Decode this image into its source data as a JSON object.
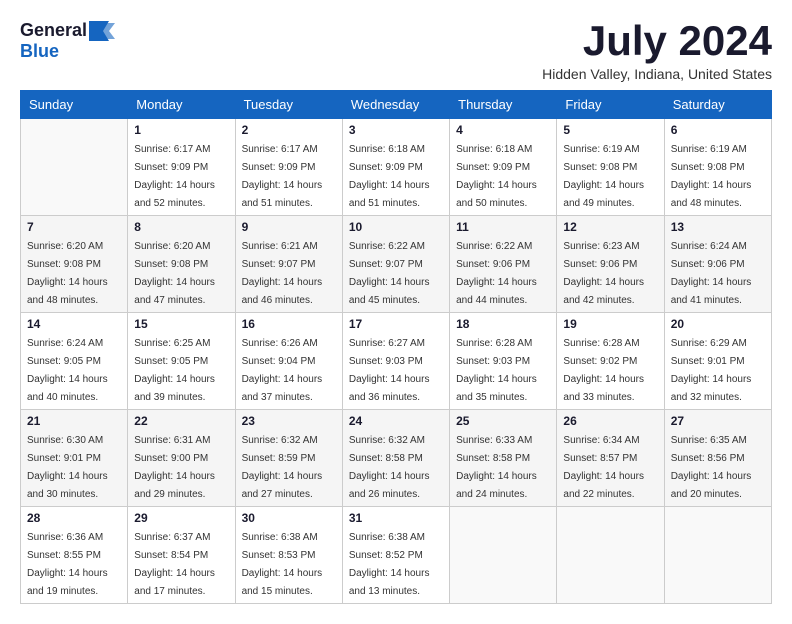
{
  "header": {
    "logo_general": "General",
    "logo_blue": "Blue",
    "title": "July 2024",
    "subtitle": "Hidden Valley, Indiana, United States"
  },
  "weekdays": [
    "Sunday",
    "Monday",
    "Tuesday",
    "Wednesday",
    "Thursday",
    "Friday",
    "Saturday"
  ],
  "weeks": [
    [
      {
        "day": "",
        "sunrise": "",
        "sunset": "",
        "daylight": ""
      },
      {
        "day": "1",
        "sunrise": "Sunrise: 6:17 AM",
        "sunset": "Sunset: 9:09 PM",
        "daylight": "Daylight: 14 hours and 52 minutes."
      },
      {
        "day": "2",
        "sunrise": "Sunrise: 6:17 AM",
        "sunset": "Sunset: 9:09 PM",
        "daylight": "Daylight: 14 hours and 51 minutes."
      },
      {
        "day": "3",
        "sunrise": "Sunrise: 6:18 AM",
        "sunset": "Sunset: 9:09 PM",
        "daylight": "Daylight: 14 hours and 51 minutes."
      },
      {
        "day": "4",
        "sunrise": "Sunrise: 6:18 AM",
        "sunset": "Sunset: 9:09 PM",
        "daylight": "Daylight: 14 hours and 50 minutes."
      },
      {
        "day": "5",
        "sunrise": "Sunrise: 6:19 AM",
        "sunset": "Sunset: 9:08 PM",
        "daylight": "Daylight: 14 hours and 49 minutes."
      },
      {
        "day": "6",
        "sunrise": "Sunrise: 6:19 AM",
        "sunset": "Sunset: 9:08 PM",
        "daylight": "Daylight: 14 hours and 48 minutes."
      }
    ],
    [
      {
        "day": "7",
        "sunrise": "Sunrise: 6:20 AM",
        "sunset": "Sunset: 9:08 PM",
        "daylight": "Daylight: 14 hours and 48 minutes."
      },
      {
        "day": "8",
        "sunrise": "Sunrise: 6:20 AM",
        "sunset": "Sunset: 9:08 PM",
        "daylight": "Daylight: 14 hours and 47 minutes."
      },
      {
        "day": "9",
        "sunrise": "Sunrise: 6:21 AM",
        "sunset": "Sunset: 9:07 PM",
        "daylight": "Daylight: 14 hours and 46 minutes."
      },
      {
        "day": "10",
        "sunrise": "Sunrise: 6:22 AM",
        "sunset": "Sunset: 9:07 PM",
        "daylight": "Daylight: 14 hours and 45 minutes."
      },
      {
        "day": "11",
        "sunrise": "Sunrise: 6:22 AM",
        "sunset": "Sunset: 9:06 PM",
        "daylight": "Daylight: 14 hours and 44 minutes."
      },
      {
        "day": "12",
        "sunrise": "Sunrise: 6:23 AM",
        "sunset": "Sunset: 9:06 PM",
        "daylight": "Daylight: 14 hours and 42 minutes."
      },
      {
        "day": "13",
        "sunrise": "Sunrise: 6:24 AM",
        "sunset": "Sunset: 9:06 PM",
        "daylight": "Daylight: 14 hours and 41 minutes."
      }
    ],
    [
      {
        "day": "14",
        "sunrise": "Sunrise: 6:24 AM",
        "sunset": "Sunset: 9:05 PM",
        "daylight": "Daylight: 14 hours and 40 minutes."
      },
      {
        "day": "15",
        "sunrise": "Sunrise: 6:25 AM",
        "sunset": "Sunset: 9:05 PM",
        "daylight": "Daylight: 14 hours and 39 minutes."
      },
      {
        "day": "16",
        "sunrise": "Sunrise: 6:26 AM",
        "sunset": "Sunset: 9:04 PM",
        "daylight": "Daylight: 14 hours and 37 minutes."
      },
      {
        "day": "17",
        "sunrise": "Sunrise: 6:27 AM",
        "sunset": "Sunset: 9:03 PM",
        "daylight": "Daylight: 14 hours and 36 minutes."
      },
      {
        "day": "18",
        "sunrise": "Sunrise: 6:28 AM",
        "sunset": "Sunset: 9:03 PM",
        "daylight": "Daylight: 14 hours and 35 minutes."
      },
      {
        "day": "19",
        "sunrise": "Sunrise: 6:28 AM",
        "sunset": "Sunset: 9:02 PM",
        "daylight": "Daylight: 14 hours and 33 minutes."
      },
      {
        "day": "20",
        "sunrise": "Sunrise: 6:29 AM",
        "sunset": "Sunset: 9:01 PM",
        "daylight": "Daylight: 14 hours and 32 minutes."
      }
    ],
    [
      {
        "day": "21",
        "sunrise": "Sunrise: 6:30 AM",
        "sunset": "Sunset: 9:01 PM",
        "daylight": "Daylight: 14 hours and 30 minutes."
      },
      {
        "day": "22",
        "sunrise": "Sunrise: 6:31 AM",
        "sunset": "Sunset: 9:00 PM",
        "daylight": "Daylight: 14 hours and 29 minutes."
      },
      {
        "day": "23",
        "sunrise": "Sunrise: 6:32 AM",
        "sunset": "Sunset: 8:59 PM",
        "daylight": "Daylight: 14 hours and 27 minutes."
      },
      {
        "day": "24",
        "sunrise": "Sunrise: 6:32 AM",
        "sunset": "Sunset: 8:58 PM",
        "daylight": "Daylight: 14 hours and 26 minutes."
      },
      {
        "day": "25",
        "sunrise": "Sunrise: 6:33 AM",
        "sunset": "Sunset: 8:58 PM",
        "daylight": "Daylight: 14 hours and 24 minutes."
      },
      {
        "day": "26",
        "sunrise": "Sunrise: 6:34 AM",
        "sunset": "Sunset: 8:57 PM",
        "daylight": "Daylight: 14 hours and 22 minutes."
      },
      {
        "day": "27",
        "sunrise": "Sunrise: 6:35 AM",
        "sunset": "Sunset: 8:56 PM",
        "daylight": "Daylight: 14 hours and 20 minutes."
      }
    ],
    [
      {
        "day": "28",
        "sunrise": "Sunrise: 6:36 AM",
        "sunset": "Sunset: 8:55 PM",
        "daylight": "Daylight: 14 hours and 19 minutes."
      },
      {
        "day": "29",
        "sunrise": "Sunrise: 6:37 AM",
        "sunset": "Sunset: 8:54 PM",
        "daylight": "Daylight: 14 hours and 17 minutes."
      },
      {
        "day": "30",
        "sunrise": "Sunrise: 6:38 AM",
        "sunset": "Sunset: 8:53 PM",
        "daylight": "Daylight: 14 hours and 15 minutes."
      },
      {
        "day": "31",
        "sunrise": "Sunrise: 6:38 AM",
        "sunset": "Sunset: 8:52 PM",
        "daylight": "Daylight: 14 hours and 13 minutes."
      },
      {
        "day": "",
        "sunrise": "",
        "sunset": "",
        "daylight": ""
      },
      {
        "day": "",
        "sunrise": "",
        "sunset": "",
        "daylight": ""
      },
      {
        "day": "",
        "sunrise": "",
        "sunset": "",
        "daylight": ""
      }
    ]
  ]
}
